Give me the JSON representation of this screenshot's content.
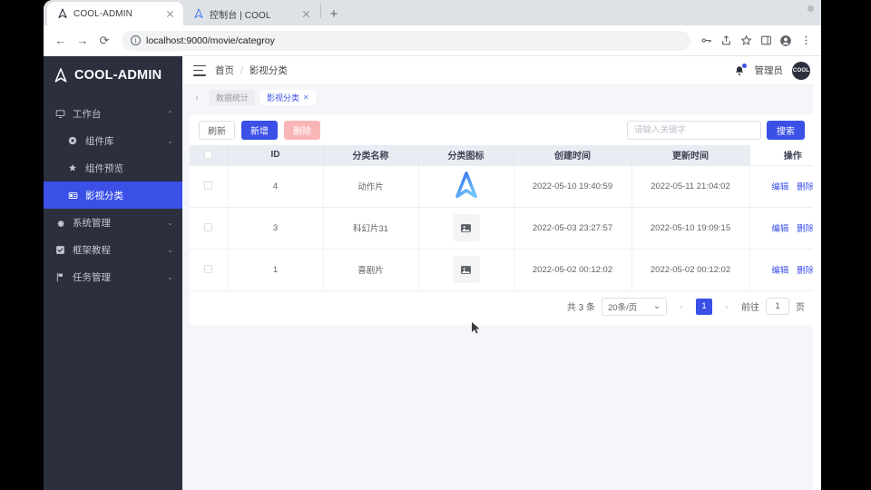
{
  "browser": {
    "tabs": [
      {
        "title": "COOL-ADMIN",
        "favicon": "cool-logo-icon",
        "active": true
      },
      {
        "title": "控制台 | COOL",
        "favicon": "cool-logo-icon",
        "active": false
      }
    ],
    "new_tab_label": "+",
    "nav": {
      "back": "←",
      "forward": "→",
      "reload": "⟳"
    },
    "address": {
      "url": "localhost:9000/movie/categroy",
      "info_icon": "info-icon"
    },
    "toolbar_icons": [
      "key-icon",
      "share-icon",
      "bookmark-star-icon",
      "sidebar-panel-icon",
      "profile-icon",
      "browser-menu-icon"
    ]
  },
  "sidebar": {
    "brand": "COOL-ADMIN",
    "items": [
      {
        "label": "工作台",
        "icon": "monitor-icon",
        "level": 0,
        "arrow": "⌃",
        "active": false
      },
      {
        "label": "组件库",
        "icon": "gear-circle-icon",
        "level": 1,
        "arrow": "⌄",
        "active": false
      },
      {
        "label": "组件预览",
        "icon": "star-icon",
        "level": 1,
        "arrow": "",
        "active": false
      },
      {
        "label": "影视分类",
        "icon": "film-icon",
        "level": 1,
        "arrow": "",
        "active": true
      },
      {
        "label": "系统管理",
        "icon": "gear-icon",
        "level": 0,
        "arrow": "⌄",
        "active": false
      },
      {
        "label": "框架教程",
        "icon": "check-square-icon",
        "level": 0,
        "arrow": "⌄",
        "active": false
      },
      {
        "label": "任务管理",
        "icon": "flag-icon",
        "level": 0,
        "arrow": "⌄",
        "active": false
      }
    ]
  },
  "header": {
    "menu_toggle": "hamburger-icon",
    "breadcrumb": {
      "home": "首页",
      "separator": "/",
      "current": "影视分类"
    },
    "notification_icon": "bell-icon",
    "username": "管理员",
    "avatar_text": "COOL"
  },
  "tagbar": {
    "prev_arrow": "‹",
    "tags": [
      {
        "label": "数据统计",
        "closable": false,
        "active": false
      },
      {
        "label": "影视分类",
        "closable": true,
        "close": "✕",
        "active": true
      }
    ]
  },
  "toolbar": {
    "refresh_label": "刷新",
    "add_label": "新增",
    "delete_label": "删除",
    "search_placeholder": "请输入关键字",
    "search_value": "",
    "search_button": "搜索"
  },
  "table": {
    "columns": [
      "",
      "ID",
      "分类名称",
      "分类图标",
      "创建时间",
      "更新时间",
      "操作"
    ],
    "rows": [
      {
        "id": "4",
        "name": "动作片",
        "icon": "cool-logo-image",
        "created_at": "2022-05-10 19:40:59",
        "updated_at": "2022-05-11 21:04:02",
        "edit": "编辑",
        "delete": "删除"
      },
      {
        "id": "3",
        "name": "科幻片31",
        "icon": "broken-image-placeholder",
        "created_at": "2022-05-03 23:27:57",
        "updated_at": "2022-05-10 19:09:15",
        "edit": "编辑",
        "delete": "删除"
      },
      {
        "id": "1",
        "name": "喜剧片",
        "icon": "broken-image-placeholder",
        "created_at": "2022-05-02 00:12:02",
        "updated_at": "2022-05-02 00:12:02",
        "edit": "编辑",
        "delete": "删除"
      }
    ]
  },
  "pagination": {
    "total_text": "共 3 条",
    "page_size": "20条/页",
    "prev": "‹",
    "next": "›",
    "current_page": "1",
    "goto_label": "前往",
    "goto_value": "1",
    "page_unit": "页"
  },
  "colors": {
    "accent": "#3a50e6",
    "sidebar_bg": "#2b2f3e",
    "danger_disabled": "#fab6b6",
    "table_header_bg": "#eaecf3"
  }
}
